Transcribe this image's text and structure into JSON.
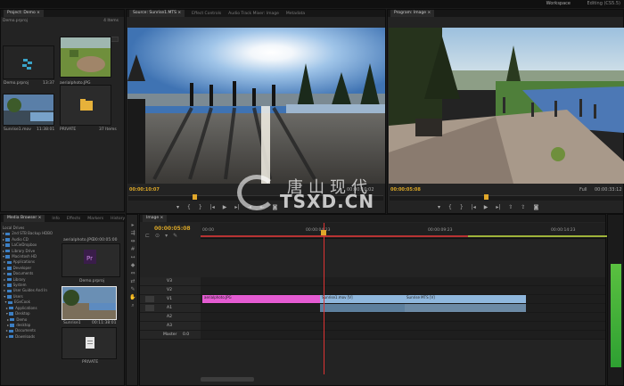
{
  "app": {
    "workspace_label": "Workspace",
    "workspace_value": "Editing (CS5.5)"
  },
  "project": {
    "tab": "Project: Demo ×",
    "file": "Demo.prproj",
    "count": "4 Items",
    "search_placeholder": "In: All",
    "items": [
      {
        "name": "Demo.prproj",
        "dur": "13:37"
      },
      {
        "name": "aerialphoto.JPG",
        "dur": ""
      },
      {
        "name": "Sunrise1.mov",
        "dur": "11:38:01"
      },
      {
        "name": "PRIVATE",
        "dur": "37 Items"
      }
    ]
  },
  "source": {
    "tabs": [
      "Source: Sunrise1.MTS ×",
      "Effect Controls",
      "Audio Track Mixer: Image",
      "Metadata"
    ],
    "timecode": "00:00:10:07",
    "duration": "00:00:10:02"
  },
  "program": {
    "tabs": [
      "Program: Image ×"
    ],
    "timecode": "00:00:05:08",
    "duration": "00:00:33:12",
    "zoom": "Full"
  },
  "media_browser": {
    "tabs": [
      "Media Browser ×",
      "Info",
      "Effects",
      "Markers",
      "History"
    ],
    "tree": [
      "Local Drives",
      "2nd STB Backup HDBO",
      "Audio CD",
      "LaCieDropbox",
      "Library Drive",
      "Macintosh HD",
      "Applications",
      "Developer",
      "Documents",
      "Library",
      "System",
      "User Guides And In",
      "Users",
      "EGeCook",
      "Applications",
      "Desktop",
      "Demo",
      "desktop",
      "Documents",
      "Downloads"
    ],
    "thumbs": [
      {
        "name": "aerialphoto.JPG",
        "dur": "00:00:05:00"
      },
      {
        "name": "Demo.prproj",
        "dur": ""
      },
      {
        "name": "Sunrise1",
        "dur": "00:11:38:01"
      },
      {
        "name": "PRIVATE",
        "dur": ""
      }
    ]
  },
  "timeline": {
    "tab": "Image ×",
    "timecode": "00:00:05:08",
    "ruler": [
      "00:00",
      "00:00:04:23",
      "00:00:09:23",
      "00:00:14:23"
    ],
    "video_tracks": [
      "V3",
      "V2",
      "V1"
    ],
    "audio_tracks": [
      "A1",
      "A2",
      "A3"
    ],
    "master_label": "Master",
    "master_value": "0.0",
    "clips": [
      {
        "name": "aerialphoto.JPG",
        "color": "pink"
      },
      {
        "name": "Sunrise1.mov [V]",
        "color": "blue"
      },
      {
        "name": "Sunrise MTS [V]",
        "color": "blue"
      },
      {
        "name": "",
        "color": "ablue"
      },
      {
        "name": "",
        "color": "ablue2"
      }
    ]
  },
  "watermark": {
    "cn": "唐山现代",
    "en": "TSXD.CN"
  },
  "colors": {
    "accent": "#d8a526",
    "clip_pink": "#e45bd2",
    "clip_blue": "#8fb7dd",
    "playhead": "#dd3333"
  }
}
